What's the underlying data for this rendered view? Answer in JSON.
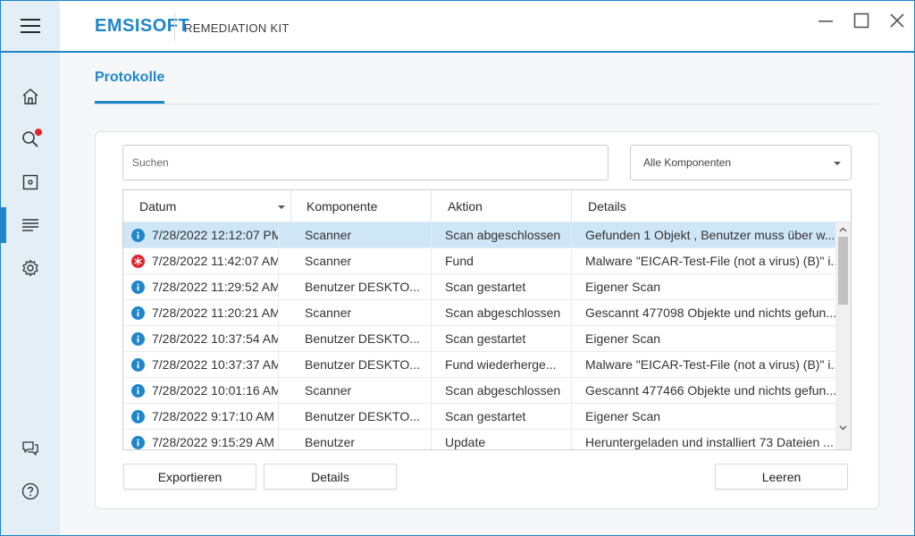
{
  "app": {
    "brand": "EMSISOFT",
    "subtitle": "REMEDIATION KIT"
  },
  "tab": {
    "label": "Protokolle"
  },
  "search": {
    "placeholder": "Suchen",
    "value": ""
  },
  "filter": {
    "selected": "Alle Komponenten"
  },
  "columns": [
    "Datum",
    "Komponente",
    "Aktion",
    "Details"
  ],
  "rows": [
    {
      "icon": "info-icon",
      "date": "7/28/2022 12:12:07 PM",
      "component": "Scanner",
      "action": "Scan abgeschlossen",
      "details": "Gefunden 1 Objekt , Benutzer muss über w..."
    },
    {
      "icon": "malware-icon",
      "date": "7/28/2022 11:42:07 AM",
      "component": "Scanner",
      "action": "Fund",
      "details": "Malware \"EICAR-Test-File (not a virus) (B)\" i..."
    },
    {
      "icon": "info-icon",
      "date": "7/28/2022 11:29:52 AM",
      "component": "Benutzer DESKTO...",
      "action": "Scan gestartet",
      "details": "Eigener Scan"
    },
    {
      "icon": "info-icon",
      "date": "7/28/2022 11:20:21 AM",
      "component": "Scanner",
      "action": "Scan abgeschlossen",
      "details": "Gescannt 477098 Objekte und nichts gefun..."
    },
    {
      "icon": "info-icon",
      "date": "7/28/2022 10:37:54 AM",
      "component": "Benutzer DESKTO...",
      "action": "Scan gestartet",
      "details": "Eigener Scan"
    },
    {
      "icon": "info-icon",
      "date": "7/28/2022 10:37:37 AM",
      "component": "Benutzer DESKTO...",
      "action": "Fund wiederherge...",
      "details": "Malware \"EICAR-Test-File (not a virus) (B)\" i..."
    },
    {
      "icon": "info-icon",
      "date": "7/28/2022 10:01:16 AM",
      "component": "Scanner",
      "action": "Scan abgeschlossen",
      "details": "Gescannt 477466 Objekte und nichts gefun..."
    },
    {
      "icon": "info-icon",
      "date": "7/28/2022 9:17:10 AM",
      "component": "Benutzer DESKTO...",
      "action": "Scan gestartet",
      "details": "Eigener Scan"
    },
    {
      "icon": "info-icon",
      "date": "7/28/2022 9:15:29 AM",
      "component": "Benutzer",
      "action": "Update",
      "details": "Heruntergeladen und installiert 73 Dateien ..."
    }
  ],
  "buttons": {
    "export": "Exportieren",
    "details": "Details",
    "clear": "Leeren"
  },
  "colors": {
    "accent": "#1f86c9",
    "sidebar": "#e3eef6",
    "selected_row": "#cfe6f7",
    "info": "#1f86c9",
    "malware": "#e2242b",
    "notification_dot": "#e2242b"
  }
}
